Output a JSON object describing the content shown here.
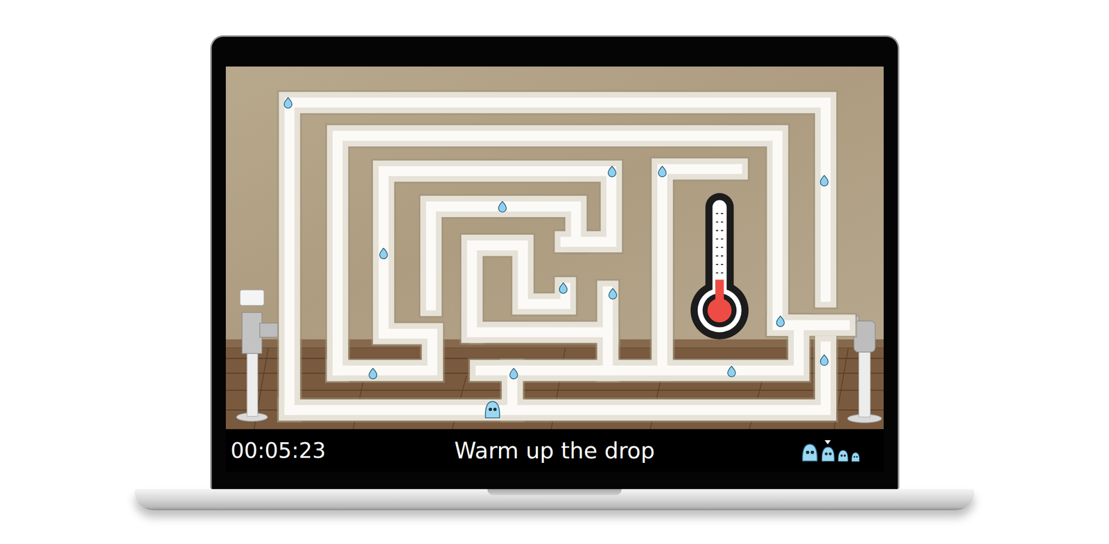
{
  "game": {
    "thermometer": {
      "level": 0.2
    }
  },
  "status_bar": {
    "timer": "00:05:23",
    "title": "Warm up the drop",
    "sizes": [
      {
        "kind": "xl",
        "selected": false
      },
      {
        "kind": "l",
        "selected": true
      },
      {
        "kind": "m",
        "selected": false
      },
      {
        "kind": "s",
        "selected": false
      }
    ]
  }
}
